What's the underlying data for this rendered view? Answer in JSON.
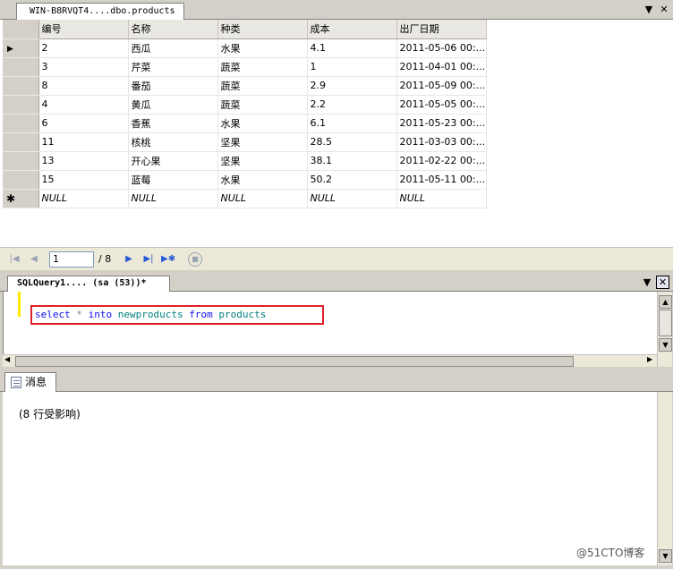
{
  "results_tab": {
    "title": "WIN-B8RVQT4....dbo.products"
  },
  "grid": {
    "columns": [
      "编号",
      "名称",
      "种类",
      "成本",
      "出厂日期"
    ],
    "rows": [
      [
        "2",
        "西瓜",
        "水果",
        "4.1",
        "2011-05-06 00:..."
      ],
      [
        "3",
        "芹菜",
        "蔬菜",
        "1",
        "2011-04-01 00:..."
      ],
      [
        "8",
        "番茄",
        "蔬菜",
        "2.9",
        "2011-05-09 00:..."
      ],
      [
        "4",
        "黄瓜",
        "蔬菜",
        "2.2",
        "2011-05-05 00:..."
      ],
      [
        "6",
        "香蕉",
        "水果",
        "6.1",
        "2011-05-23 00:..."
      ],
      [
        "11",
        "核桃",
        "坚果",
        "28.5",
        "2011-03-03 00:..."
      ],
      [
        "13",
        "开心果",
        "坚果",
        "38.1",
        "2011-02-22 00:..."
      ],
      [
        "15",
        "蓝莓",
        "水果",
        "50.2",
        "2011-05-11 00:..."
      ]
    ],
    "new_row": [
      "NULL",
      "NULL",
      "NULL",
      "NULL",
      "NULL"
    ],
    "current_row_marker": "▶",
    "new_row_marker": "✱"
  },
  "navigator": {
    "current": "1",
    "total": "/ 8"
  },
  "editor": {
    "tab_title": "SQLQuery1....  (sa (53))*",
    "code": {
      "kw1": "select",
      "op": "*",
      "kw2": "into",
      "target": "newproducts",
      "kw3": "from",
      "source": "products"
    }
  },
  "messages": {
    "tab_label": "消息",
    "text": "(8 行受影响)"
  },
  "watermark": "@51CTO博客",
  "colors": {
    "highlight_border": "#e0202a",
    "keyword": "#1010f0",
    "identifier": "#008080",
    "margin_marker": "#ffea00"
  },
  "icons": [
    "dropdown-icon",
    "close-icon",
    "first-record-icon",
    "prev-record-icon",
    "next-record-icon",
    "last-record-icon",
    "new-record-icon",
    "stop-icon",
    "messages-icon"
  ]
}
